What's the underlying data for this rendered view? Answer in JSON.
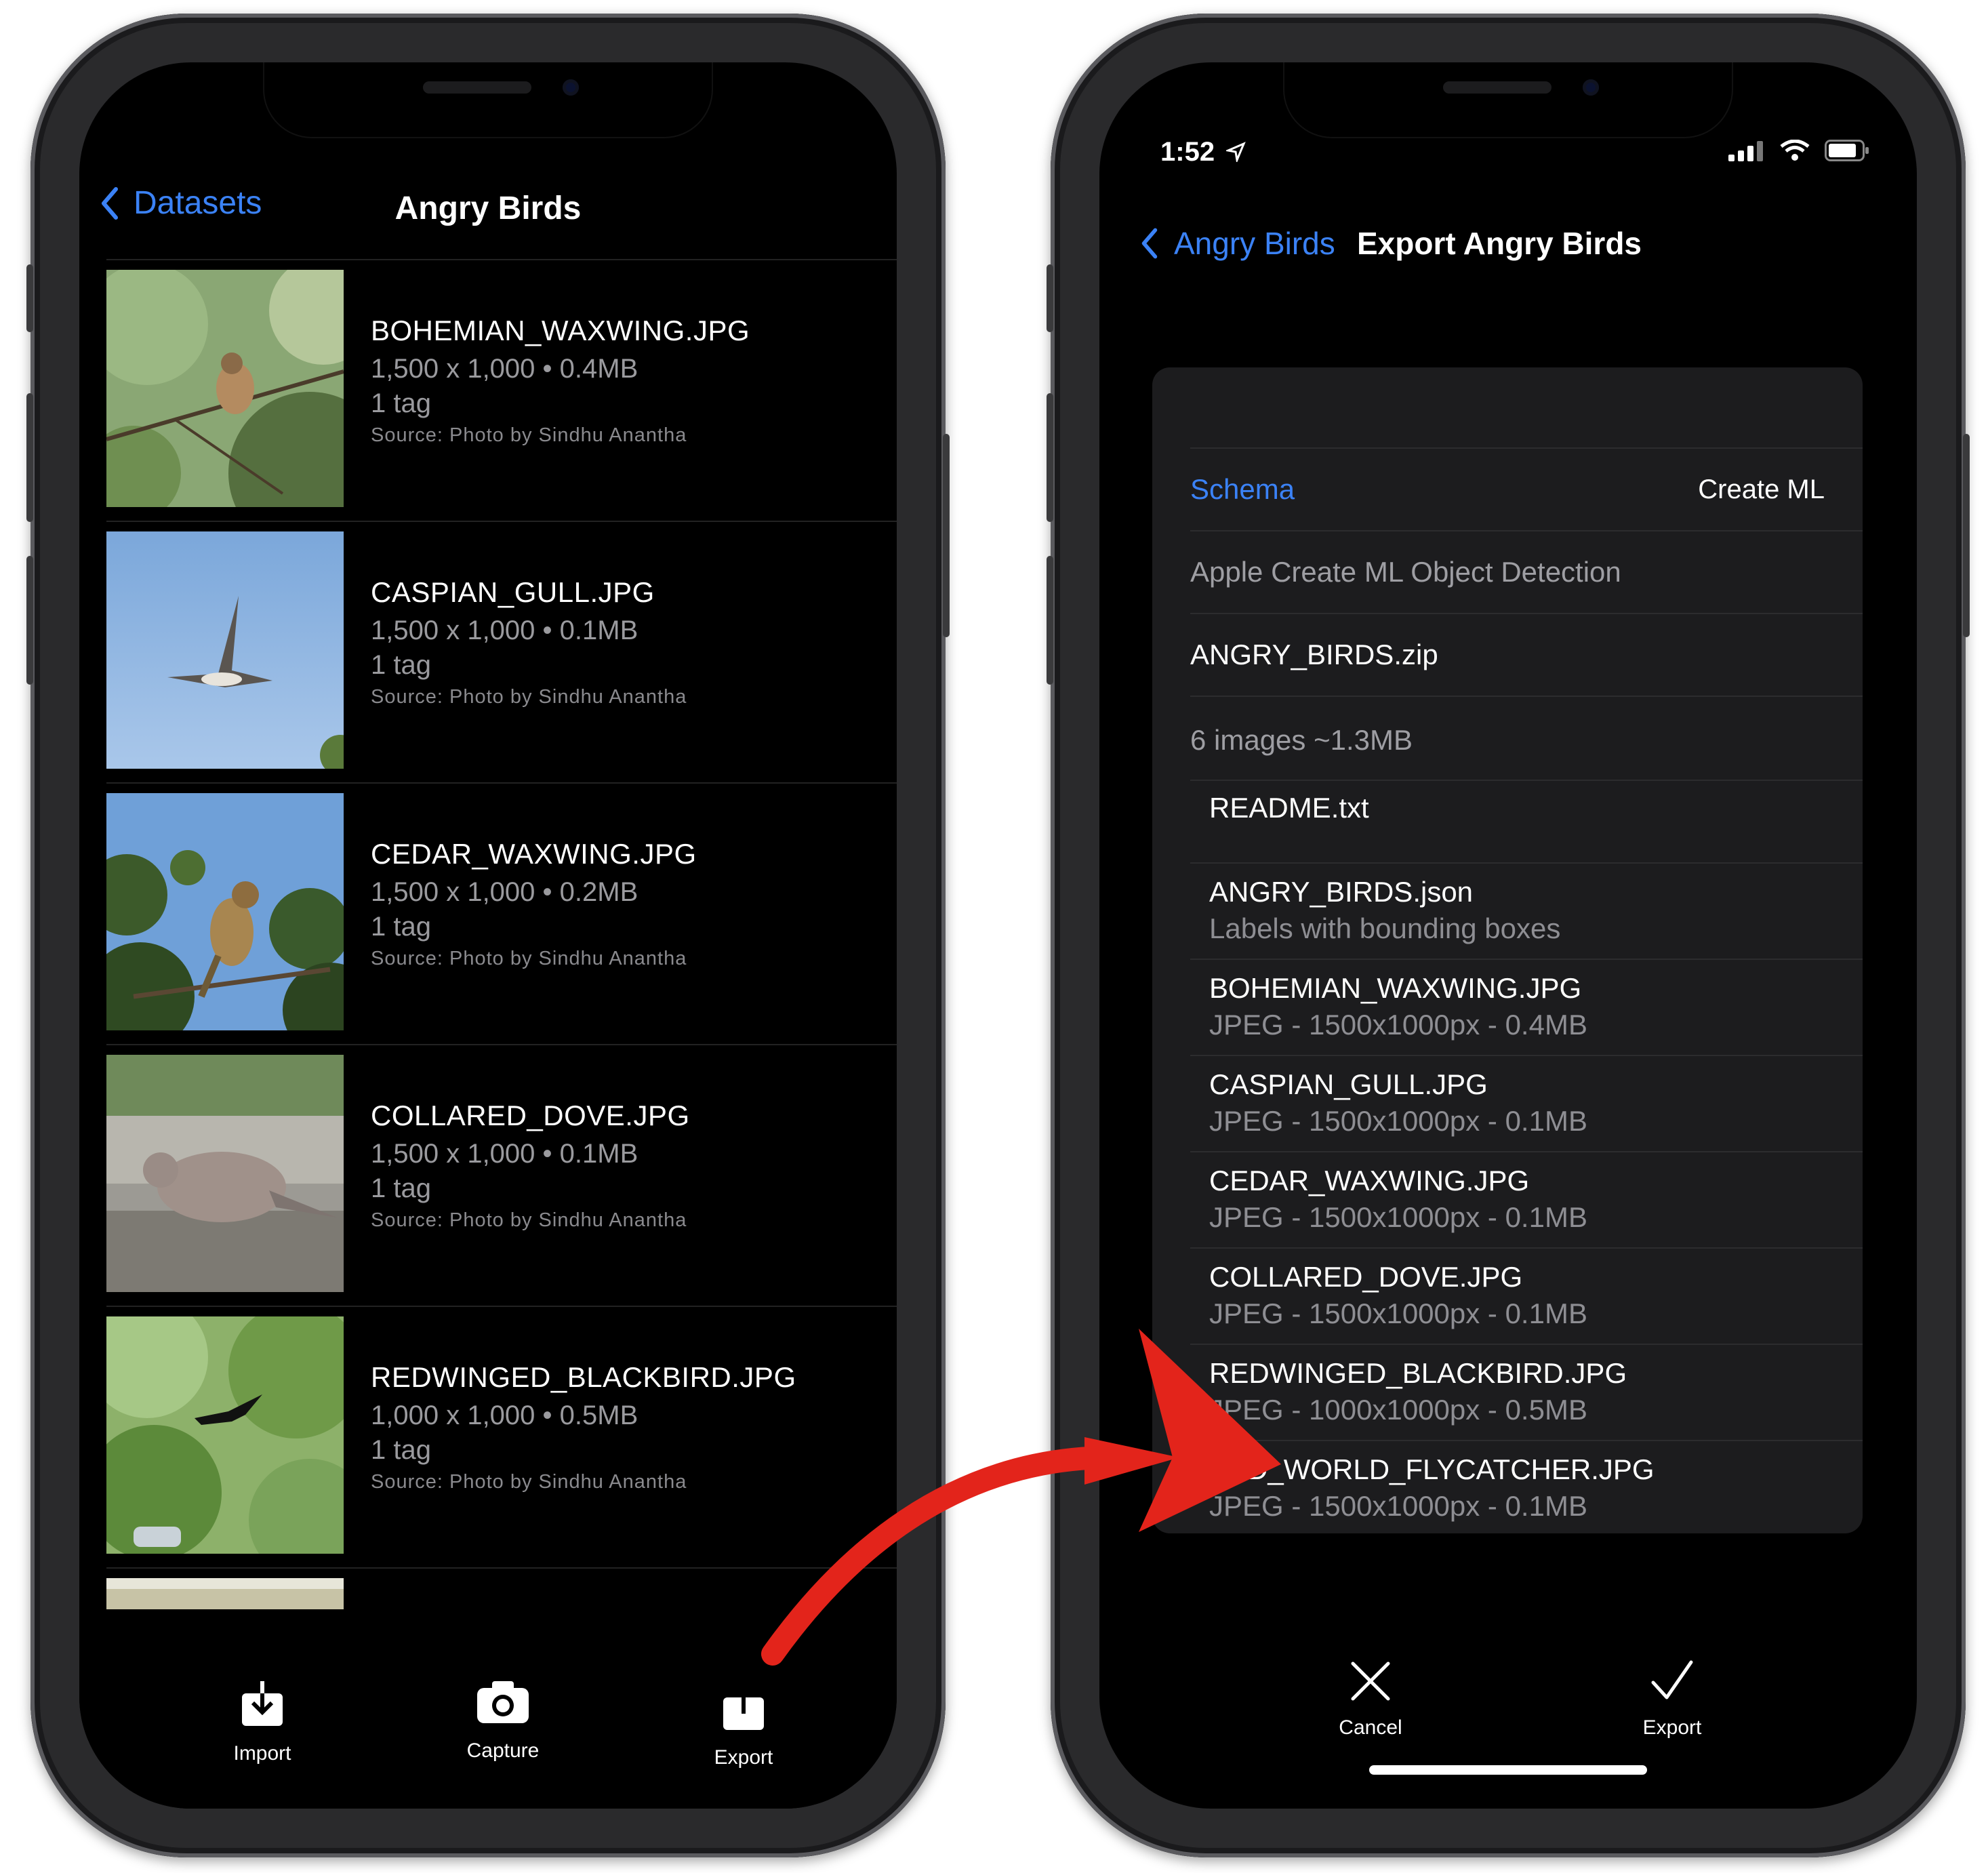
{
  "left": {
    "nav": {
      "back_label": "Datasets",
      "title": "Angry Birds"
    },
    "images": [
      {
        "file": "BOHEMIAN_WAXWING.JPG",
        "dims": "1,500 x 1,000 • 0.4MB",
        "tags": "1 tag",
        "source": "Source: Photo by Sindhu Anantha"
      },
      {
        "file": "CASPIAN_GULL.JPG",
        "dims": "1,500 x 1,000 • 0.1MB",
        "tags": "1 tag",
        "source": "Source: Photo by Sindhu Anantha"
      },
      {
        "file": "CEDAR_WAXWING.JPG",
        "dims": "1,500 x 1,000 • 0.2MB",
        "tags": "1 tag",
        "source": "Source: Photo by Sindhu Anantha"
      },
      {
        "file": "COLLARED_DOVE.JPG",
        "dims": "1,500 x 1,000 • 0.1MB",
        "tags": "1 tag",
        "source": "Source: Photo by Sindhu Anantha"
      },
      {
        "file": "REDWINGED_BLACKBIRD.JPG",
        "dims": "1,000 x 1,000 • 0.5MB",
        "tags": "1 tag",
        "source": "Source: Photo by Sindhu Anantha"
      }
    ],
    "toolbar": {
      "import": "Import",
      "capture": "Capture",
      "export": "Export"
    }
  },
  "right": {
    "status": {
      "time": "1:52"
    },
    "nav": {
      "back_label": "Angry Birds",
      "title": "Export Angry Birds"
    },
    "schema": {
      "label": "Schema",
      "value": "Create ML"
    },
    "format": "Apple Create ML Object Detection",
    "zip_name": "ANGRY_BIRDS.zip",
    "summary": "6 images ~1.3MB",
    "files": [
      {
        "name": "README.txt",
        "detail": ""
      },
      {
        "name": "ANGRY_BIRDS.json",
        "detail": "Labels with bounding boxes"
      },
      {
        "name": "BOHEMIAN_WAXWING.JPG",
        "detail": "JPEG - 1500x1000px - 0.4MB"
      },
      {
        "name": "CASPIAN_GULL.JPG",
        "detail": "JPEG - 1500x1000px - 0.1MB"
      },
      {
        "name": "CEDAR_WAXWING.JPG",
        "detail": "JPEG - 1500x1000px - 0.1MB"
      },
      {
        "name": "COLLARED_DOVE.JPG",
        "detail": "JPEG - 1500x1000px - 0.1MB"
      },
      {
        "name": "REDWINGED_BLACKBIRD.JPG",
        "detail": "JPEG - 1000x1000px - 0.5MB"
      },
      {
        "name": "OLD_WORLD_FLYCATCHER.JPG",
        "detail": "JPEG - 1500x1000px - 0.1MB"
      }
    ],
    "actions": {
      "cancel": "Cancel",
      "export": "Export"
    }
  },
  "colors": {
    "accent": "#3b82f6",
    "arrow": "#e3241b",
    "card": "#1c1c1e"
  }
}
